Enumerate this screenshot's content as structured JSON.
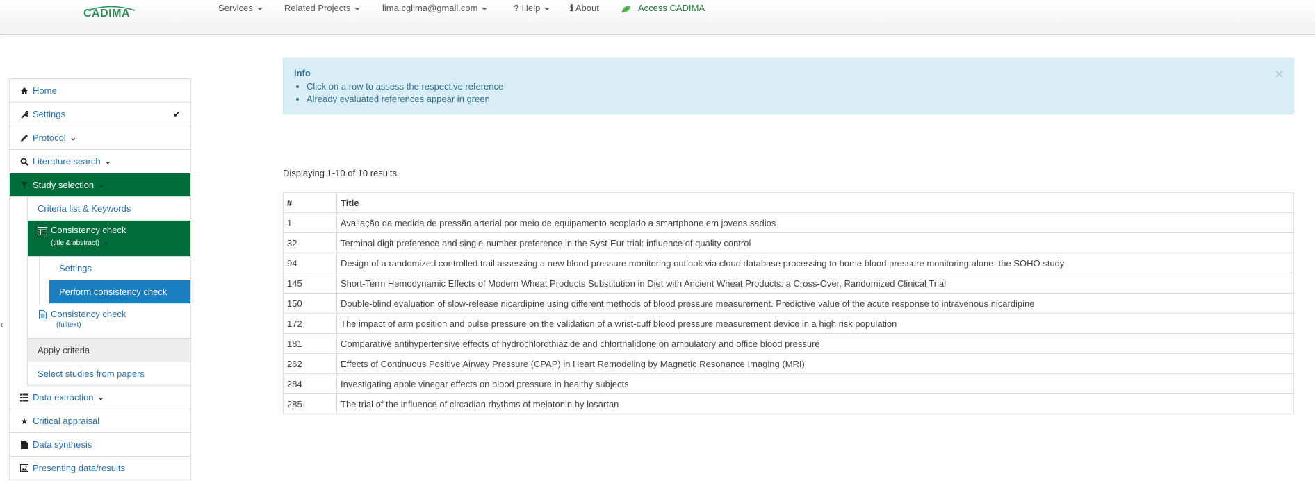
{
  "brand": "CADIMA",
  "nav": {
    "services": "Services",
    "related_projects": "Related Projects",
    "user": "lima.cglima@gmail.com",
    "help": "Help",
    "about": "About",
    "access": "Access CADIMA"
  },
  "sidebar": {
    "home": "Home",
    "settings": "Settings",
    "protocol": "Protocol",
    "literature_search": "Literature search",
    "study_selection": "Study selection",
    "criteria_list": "Criteria list & Keywords",
    "consistency_check_ta": "Consistency check",
    "consistency_check_ta_sub": "(title & abstract)",
    "cc_settings": "Settings",
    "perform_cc": "Perform consistency check",
    "consistency_check_ft": "Consistency check",
    "consistency_check_ft_sub": "(fulltext)",
    "apply_criteria": "Apply criteria",
    "select_studies": "Select studies from papers",
    "data_extraction": "Data extraction",
    "critical_appraisal": "Critical appraisal",
    "data_synthesis": "Data synthesis",
    "presenting": "Presenting data/results"
  },
  "info": {
    "title": "Info",
    "items": [
      "Click on a row to assess the respective reference",
      "Already evaluated references appear in green"
    ],
    "close": "×"
  },
  "summary": "Displaying 1-10 of 10 results.",
  "table": {
    "headers": [
      "#",
      "Title"
    ],
    "rows": [
      {
        "num": "1",
        "title": "Avaliação da medida de pressão arterial por meio de equipamento acoplado a smartphone em jovens sadios"
      },
      {
        "num": "32",
        "title": "Terminal digit preference and single-number preference in the Syst-Eur trial: influence of quality control"
      },
      {
        "num": "94",
        "title": "Design of a randomized controlled trail assessing a new blood pressure monitoring outlook via cloud database processing to home blood pressure monitoring alone: the SOHO study"
      },
      {
        "num": "145",
        "title": "Short-Term Hemodynamic Effects of Modern Wheat Products Substitution in Diet with Ancient Wheat Products: a Cross-Over, Randomized Clinical Trial"
      },
      {
        "num": "150",
        "title": "Double-blind evaluation of slow-release nicardipine using different methods of blood pressure measurement. Predictive value of the acute response to intravenous nicardipine"
      },
      {
        "num": "172",
        "title": "The impact of arm position and pulse pressure on the validation of a wrist-cuff blood pressure measurement device in a high risk population"
      },
      {
        "num": "181",
        "title": "Comparative antihypertensive effects of hydrochlorothiazide and chlorthalidone on ambulatory and office blood pressure"
      },
      {
        "num": "262",
        "title": "Effects of Continuous Positive Airway Pressure (CPAP) in Heart Remodeling by Magnetic Resonance Imaging (MRI)"
      },
      {
        "num": "284",
        "title": "Investigating apple vinegar effects on blood pressure in healthy subjects"
      },
      {
        "num": "285",
        "title": "The trial of the influence of circadian rhythms of melatonin by losartan"
      }
    ]
  }
}
